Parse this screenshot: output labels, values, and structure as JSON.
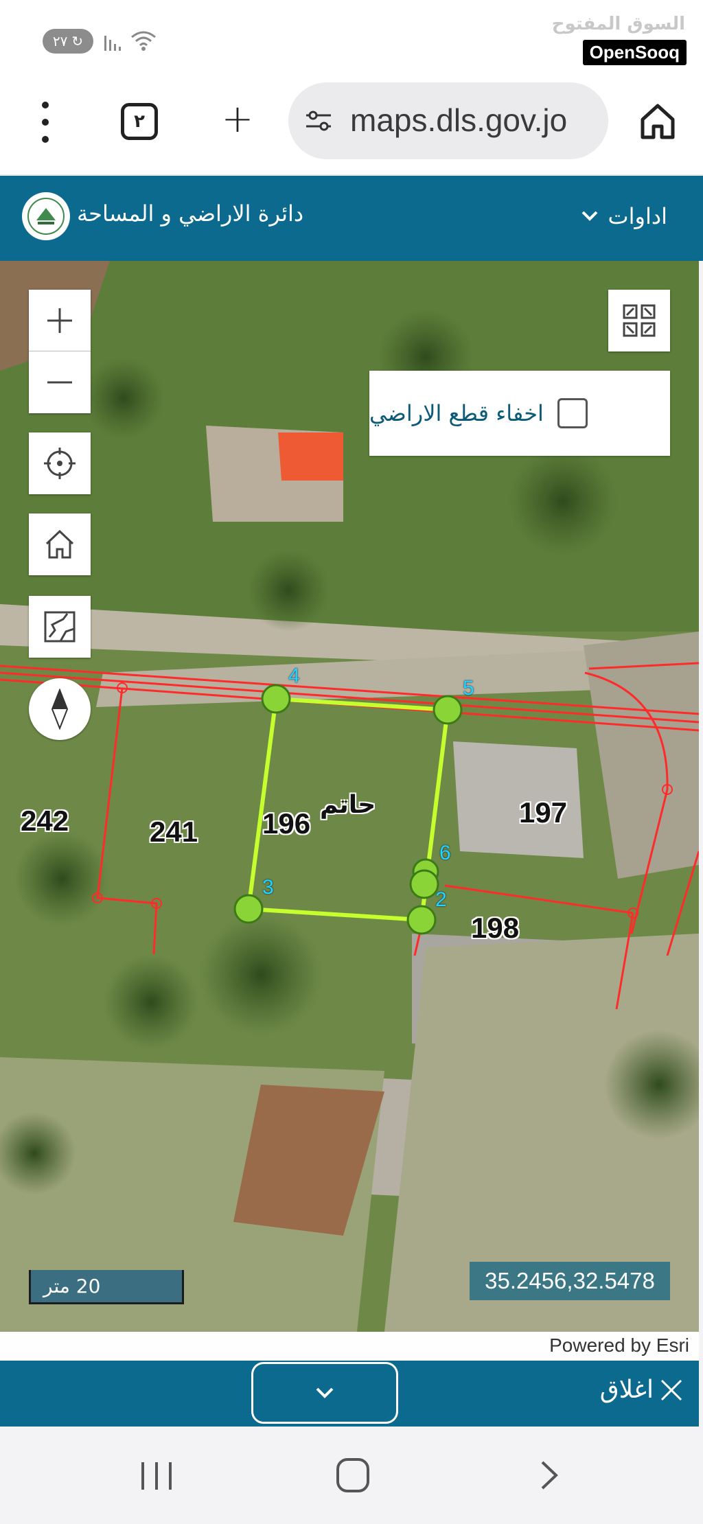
{
  "status_bar": {
    "badge_text": "٢٧",
    "brand_arabic": "السوق المفتوح",
    "brand_name": "OpenSooq"
  },
  "browser": {
    "tab_count": "٢",
    "url": "maps.dls.gov.jo",
    "icons": [
      "more-vert-icon",
      "tabs-icon",
      "plus-icon",
      "site-settings-icon",
      "home-icon"
    ]
  },
  "app_header": {
    "title": "دائرة الاراضي و المساحة",
    "tools_label": "اداوات",
    "bg_color": "#0b6a8d"
  },
  "map": {
    "hide_parcels_label": "اخفاء قطع الاراضي",
    "hide_parcels_checked": false,
    "parcel_numbers": [
      "242",
      "241",
      "196",
      "197",
      "198"
    ],
    "owner_name": "حاتم",
    "vertex_labels": [
      "4",
      "5",
      "3",
      "6",
      "2"
    ],
    "scale_text": "20 متر",
    "coordinates": "35.2456,32.5478",
    "attribution": "Powered by Esri",
    "boundary_color": "#ff2a2a",
    "selected_parcel_color": "#c6ff2e"
  },
  "bottom_bar": {
    "close_label": "اغلاق"
  },
  "nav_bar": {
    "icons": [
      "recent-apps-icon",
      "home-icon",
      "back-icon"
    ]
  }
}
